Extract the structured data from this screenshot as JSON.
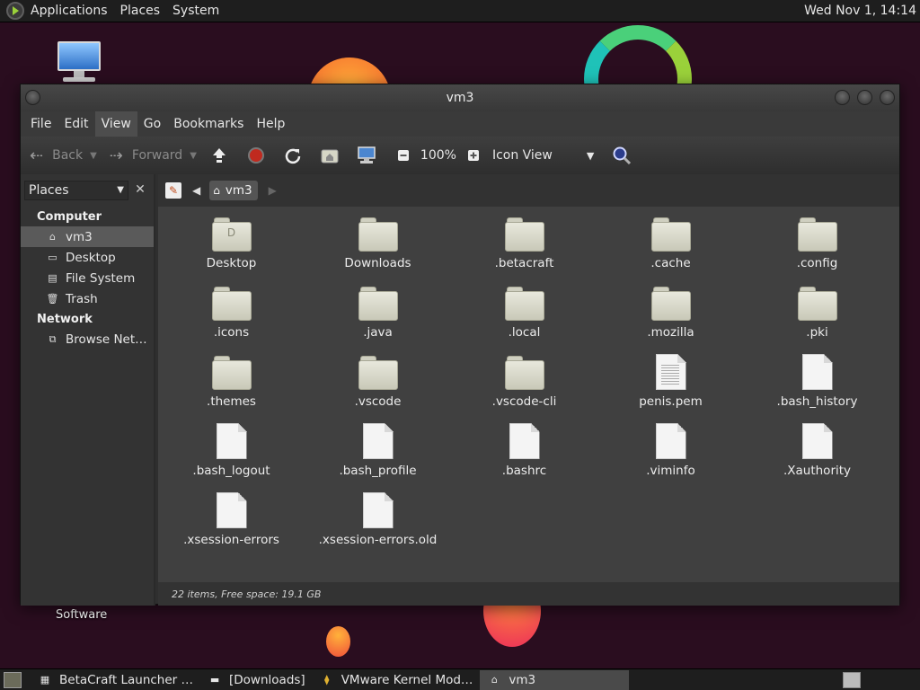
{
  "top_panel": {
    "menus": [
      "Applications",
      "Places",
      "System"
    ],
    "clock": "Wed Nov 1, 14:14"
  },
  "desktop": {
    "software_label": "Software"
  },
  "window": {
    "title": "vm3",
    "menubar": [
      "File",
      "Edit",
      "View",
      "Go",
      "Bookmarks",
      "Help"
    ],
    "toolbar": {
      "back_label": "Back",
      "forward_label": "Forward",
      "zoom": "100%",
      "view_mode": "Icon View"
    },
    "sidebar": {
      "combo_label": "Places",
      "sections": [
        {
          "title": "Computer",
          "items": [
            {
              "label": "vm3",
              "icon": "home-folder-icon",
              "selected": true
            },
            {
              "label": "Desktop",
              "icon": "desktop-folder-icon",
              "selected": false
            },
            {
              "label": "File System",
              "icon": "drive-icon",
              "selected": false
            },
            {
              "label": "Trash",
              "icon": "trash-icon",
              "selected": false
            }
          ]
        },
        {
          "title": "Network",
          "items": [
            {
              "label": "Browse Net…",
              "icon": "network-icon",
              "selected": false
            }
          ]
        }
      ]
    },
    "location": {
      "crumb": "vm3"
    },
    "files": [
      {
        "name": "Desktop",
        "kind": "folder",
        "glyph": "D"
      },
      {
        "name": "Downloads",
        "kind": "folder"
      },
      {
        "name": ".betacraft",
        "kind": "folder"
      },
      {
        "name": ".cache",
        "kind": "folder"
      },
      {
        "name": ".config",
        "kind": "folder"
      },
      {
        "name": ".icons",
        "kind": "folder"
      },
      {
        "name": ".java",
        "kind": "folder"
      },
      {
        "name": ".local",
        "kind": "folder"
      },
      {
        "name": ".mozilla",
        "kind": "folder"
      },
      {
        "name": ".pki",
        "kind": "folder"
      },
      {
        "name": ".themes",
        "kind": "folder"
      },
      {
        "name": ".vscode",
        "kind": "folder"
      },
      {
        "name": ".vscode-cli",
        "kind": "folder"
      },
      {
        "name": "penis.pem",
        "kind": "text"
      },
      {
        "name": ".bash_history",
        "kind": "file"
      },
      {
        "name": ".bash_logout",
        "kind": "file"
      },
      {
        "name": ".bash_profile",
        "kind": "file"
      },
      {
        "name": ".bashrc",
        "kind": "file"
      },
      {
        "name": ".viminfo",
        "kind": "file"
      },
      {
        "name": ".Xauthority",
        "kind": "file"
      },
      {
        "name": ".xsession-errors",
        "kind": "file"
      },
      {
        "name": ".xsession-errors.old",
        "kind": "file"
      }
    ],
    "status": "22 items, Free space: 19.1 GB"
  },
  "taskbar": {
    "tasks": [
      {
        "label": "BetaCraft Launcher …",
        "icon": "java-app-icon",
        "active": false
      },
      {
        "label": "[Downloads]",
        "icon": "folder-icon",
        "active": false
      },
      {
        "label": "VMware Kernel Mod…",
        "icon": "vmware-icon",
        "active": false
      },
      {
        "label": "vm3",
        "icon": "home-folder-icon",
        "active": true
      }
    ]
  }
}
